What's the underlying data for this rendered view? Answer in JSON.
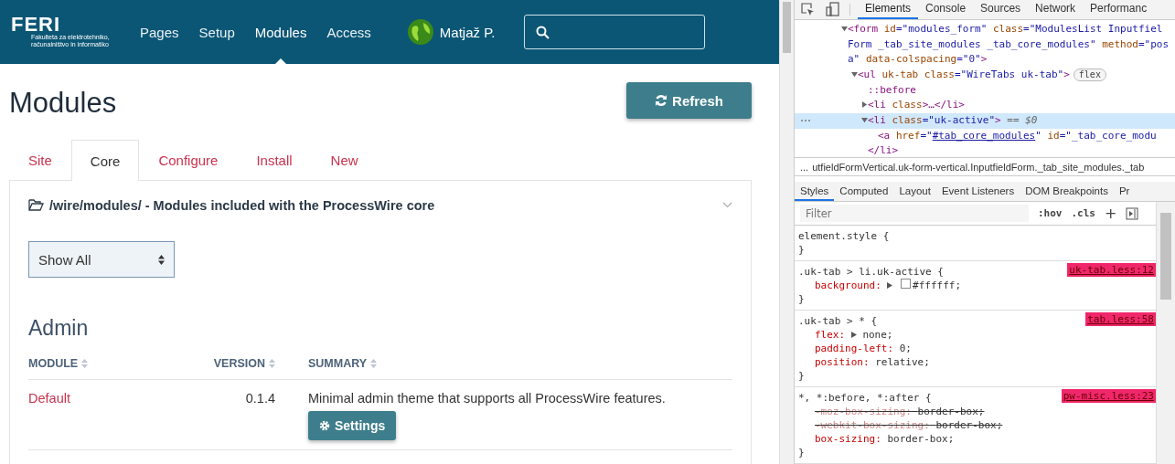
{
  "page": {
    "header": {
      "logo": {
        "wordmark": "FERI",
        "tagline": [
          "Fakulteta za elektrotehniko,",
          "računalništvo in informatiko"
        ]
      },
      "nav": [
        {
          "label": "Pages",
          "selected": false
        },
        {
          "label": "Setup",
          "selected": false
        },
        {
          "label": "Modules",
          "selected": true
        },
        {
          "label": "Access",
          "selected": false
        }
      ],
      "user": {
        "name": "Matjaž P."
      }
    },
    "title": "Modules",
    "refresh_button": "Refresh",
    "tabs": [
      {
        "label": "Site",
        "selected": false
      },
      {
        "label": "Core",
        "selected": true
      },
      {
        "label": "Configure",
        "selected": false
      },
      {
        "label": "Install",
        "selected": false
      },
      {
        "label": "New",
        "selected": false
      }
    ],
    "panel": {
      "heading": "/wire/modules/ - Modules included with the ProcessWire core",
      "filter": {
        "value": "Show All"
      },
      "section": "Admin",
      "table": {
        "columns": [
          "MODULE",
          "VERSION",
          "SUMMARY"
        ],
        "rows": [
          {
            "module": "Default",
            "version": "0.1.4",
            "summary": "Minimal admin theme that supports all ProcessWire features.",
            "button": "Settings"
          }
        ]
      }
    }
  },
  "devtools": {
    "tabs": [
      {
        "label": "Elements",
        "selected": true
      },
      {
        "label": "Console",
        "selected": false
      },
      {
        "label": "Sources",
        "selected": false
      },
      {
        "label": "Network",
        "selected": false
      },
      {
        "label": "Performanc",
        "selected": false
      }
    ],
    "dom": [
      {
        "expanded": true,
        "selected": false,
        "lines": [
          [
            {
              "t": "<form ",
              "kind": "tag"
            },
            {
              "t": "id",
              "kind": "attr"
            },
            {
              "t": "=\"modules_form\" ",
              "kind": "value"
            },
            {
              "t": "class",
              "kind": "attr"
            },
            {
              "t": "=\"ModulesList Inputfiel",
              "kind": "value"
            }
          ],
          [
            {
              "t": "Form _tab_site_modules _tab_core_modules\" ",
              "kind": "value"
            },
            {
              "t": "method",
              "kind": "attr"
            },
            {
              "t": "=\"pos",
              "kind": "value"
            }
          ],
          [
            {
              "t": "a\" ",
              "kind": "value"
            },
            {
              "t": "data-colspacing",
              "kind": "attr"
            },
            {
              "t": "=\"0\"",
              "kind": "value"
            },
            {
              "t": ">",
              "kind": "tag"
            }
          ]
        ],
        "children": [
          {
            "expanded": true,
            "selected": false,
            "badge": "flex",
            "lines": [
              [
                {
                  "t": "<ul ",
                  "kind": "tag"
                },
                {
                  "t": "uk-tab ",
                  "kind": "attr"
                },
                {
                  "t": "class",
                  "kind": "attr"
                },
                {
                  "t": "=\"WireTabs uk-tab\"",
                  "kind": "value"
                },
                {
                  "t": ">",
                  "kind": "tag"
                }
              ]
            ],
            "children": [
              {
                "selected": false,
                "lines": [
                  [
                    {
                      "t": "::before",
                      "kind": "pseudo"
                    }
                  ]
                ]
              },
              {
                "expanded": false,
                "selected": false,
                "lines": [
                  [
                    {
                      "t": "<li ",
                      "kind": "tag"
                    },
                    {
                      "t": "class",
                      "kind": "attr"
                    },
                    {
                      "t": ">…</li>",
                      "kind": "tag"
                    }
                  ]
                ]
              },
              {
                "expanded": true,
                "selected": true,
                "lines": [
                  [
                    {
                      "t": "<li ",
                      "kind": "tag"
                    },
                    {
                      "t": "class",
                      "kind": "attr"
                    },
                    {
                      "t": "=\"uk-active\"",
                      "kind": "value"
                    },
                    {
                      "t": ">",
                      "kind": "tag"
                    },
                    {
                      "t": " == $0",
                      "kind": "muted"
                    }
                  ]
                ],
                "children": [
                  {
                    "selected": false,
                    "lines": [
                      [
                        {
                          "t": "<a ",
                          "kind": "tag"
                        },
                        {
                          "t": "href",
                          "kind": "attr"
                        },
                        {
                          "t": "=\"",
                          "kind": "value"
                        },
                        {
                          "t": "#tab_core_modules",
                          "kind": "link"
                        },
                        {
                          "t": "\" ",
                          "kind": "value"
                        },
                        {
                          "t": "id",
                          "kind": "attr"
                        },
                        {
                          "t": "=\"_tab_core_modu",
                          "kind": "value"
                        }
                      ]
                    ]
                  }
                ],
                "close": [
                  {
                    "t": "</li>",
                    "kind": "tag"
                  }
                ]
              }
            ]
          }
        ]
      }
    ],
    "breadcrumb": {
      "ellipsis": "...",
      "path": "utfieldFormVertical.uk-form-vertical.InputfieldForm._tab_site_modules._tab"
    },
    "style_tabs": [
      {
        "label": "Styles",
        "selected": true
      },
      {
        "label": "Computed",
        "selected": false
      },
      {
        "label": "Layout",
        "selected": false
      },
      {
        "label": "Event Listeners",
        "selected": false
      },
      {
        "label": "DOM Breakpoints",
        "selected": false
      },
      {
        "label": "Pr",
        "selected": false
      }
    ],
    "filter": {
      "placeholder": "Filter"
    },
    "hov": ":hov",
    "cls": ".cls",
    "add": "+",
    "rules": [
      {
        "selector": "element.style {",
        "close": "}"
      },
      {
        "selector": ".uk-tab > li.uk-active {",
        "close": "}",
        "source": "uk-tab.less:12",
        "props": [
          {
            "name": "background:",
            "value": "#ffffff;",
            "expander": true,
            "swatch": true,
            "struck": false
          }
        ]
      },
      {
        "selector": ".uk-tab > * {",
        "close": "}",
        "source": "tab.less:58",
        "props": [
          {
            "name": "flex:",
            "value": "none;",
            "expander": true,
            "swatch": false,
            "struck": false
          },
          {
            "name": "padding-left:",
            "value": "0;",
            "expander": false,
            "swatch": false,
            "struck": false
          },
          {
            "name": "position:",
            "value": "relative;",
            "expander": false,
            "swatch": false,
            "struck": false
          }
        ]
      },
      {
        "selector": "*, *:before, *:after {",
        "close": "}",
        "source": "pw-misc.less:23",
        "props": [
          {
            "name": "-moz-box-sizing:",
            "value": "border-box;",
            "expander": false,
            "swatch": false,
            "struck": true
          },
          {
            "name": "-webkit-box-sizing:",
            "value": "border-box;",
            "expander": false,
            "swatch": false,
            "struck": true
          },
          {
            "name": "box-sizing:",
            "value": "border-box;",
            "expander": false,
            "swatch": false,
            "struck": false
          }
        ]
      }
    ]
  }
}
